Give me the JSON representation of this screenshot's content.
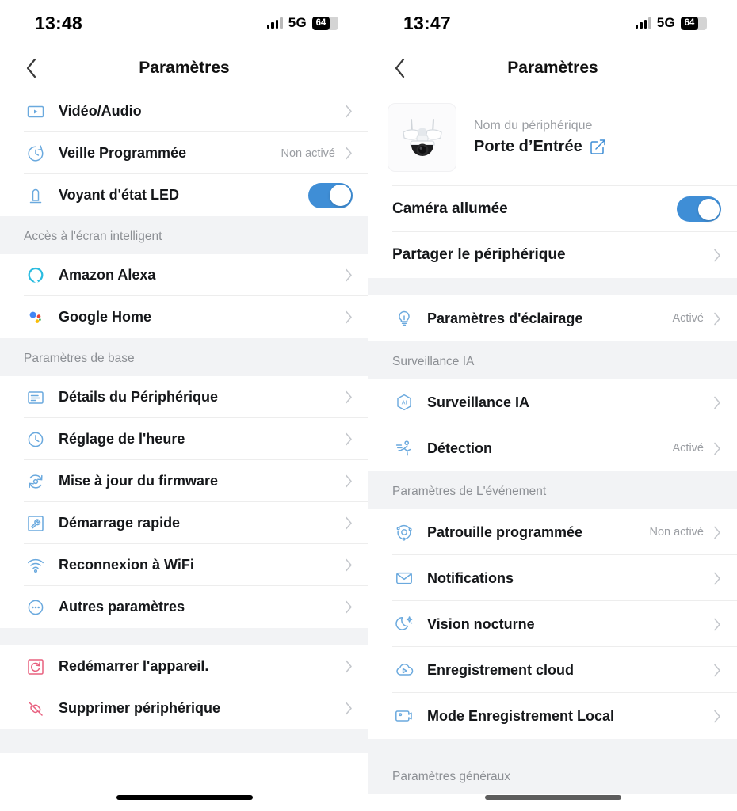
{
  "left": {
    "status": {
      "time": "13:48",
      "network": "5G",
      "battery": "64"
    },
    "nav": {
      "title": "Paramètres",
      "back": "back-chevron"
    },
    "sections": [
      {
        "header": null,
        "items": [
          {
            "icon": "video-audio-icon",
            "label": "Vidéo/Audio",
            "value": null,
            "control": "chevron"
          },
          {
            "icon": "scheduled-sleep-icon",
            "label": "Veille Programmée",
            "value": "Non activé",
            "control": "chevron"
          },
          {
            "icon": "led-indicator-icon",
            "label": "Voyant d'état LED",
            "value": null,
            "control": "toggle-on"
          }
        ]
      },
      {
        "header": "Accès à l'écran intelligent",
        "items": [
          {
            "icon": "amazon-alexa-icon",
            "label": "Amazon Alexa",
            "value": null,
            "control": "chevron"
          },
          {
            "icon": "google-home-icon",
            "label": "Google Home",
            "value": null,
            "control": "chevron"
          }
        ]
      },
      {
        "header": "Paramètres de base",
        "items": [
          {
            "icon": "device-details-icon",
            "label": "Détails du Périphérique",
            "value": null,
            "control": "chevron"
          },
          {
            "icon": "clock-icon",
            "label": "Réglage de l'heure",
            "value": null,
            "control": "chevron"
          },
          {
            "icon": "firmware-update-icon",
            "label": "Mise à jour du firmware",
            "value": null,
            "control": "chevron"
          },
          {
            "icon": "quick-start-icon",
            "label": "Démarrage rapide",
            "value": null,
            "control": "chevron"
          },
          {
            "icon": "wifi-icon",
            "label": "Reconnexion à WiFi",
            "value": null,
            "control": "chevron"
          },
          {
            "icon": "more-options-icon",
            "label": "Autres paramètres",
            "value": null,
            "control": "chevron"
          }
        ]
      },
      {
        "header": null,
        "items": [
          {
            "icon": "restart-device-icon",
            "label": "Redémarrer l'appareil.",
            "value": null,
            "control": "chevron"
          },
          {
            "icon": "unlink-device-icon",
            "label": "Supprimer périphérique",
            "value": null,
            "control": "chevron"
          }
        ]
      }
    ]
  },
  "right": {
    "status": {
      "time": "13:47",
      "network": "5G",
      "battery": "64"
    },
    "nav": {
      "title": "Paramètres",
      "back": "back-chevron"
    },
    "device": {
      "thumbnail": "floodlight-camera-thumbnail",
      "name_label": "Nom du périphérique",
      "name": "Porte d’Entrée",
      "edit_icon": "edit-pencil-icon"
    },
    "sections": [
      {
        "header": null,
        "items": [
          {
            "icon": null,
            "label": "Caméra allumée",
            "value": null,
            "control": "toggle-on"
          },
          {
            "icon": null,
            "label": "Partager le périphérique",
            "value": null,
            "control": "chevron"
          }
        ]
      },
      {
        "header": null,
        "items": [
          {
            "icon": "lighting-settings-icon",
            "label": "Paramètres d'éclairage",
            "value": "Activé",
            "control": "chevron"
          }
        ]
      },
      {
        "header": "Surveillance IA",
        "items": [
          {
            "icon": "ai-surveillance-icon",
            "label": "Surveillance IA",
            "value": null,
            "control": "chevron"
          },
          {
            "icon": "motion-detection-icon",
            "label": "Détection",
            "value": "Activé",
            "control": "chevron"
          }
        ]
      },
      {
        "header": "Paramètres de L'événement",
        "items": [
          {
            "icon": "scheduled-patrol-icon",
            "label": "Patrouille programmée",
            "value": "Non activé",
            "control": "chevron"
          },
          {
            "icon": "notifications-icon",
            "label": "Notifications",
            "value": null,
            "control": "chevron"
          },
          {
            "icon": "night-vision-icon",
            "label": "Vision nocturne",
            "value": null,
            "control": "chevron"
          },
          {
            "icon": "cloud-recording-icon",
            "label": "Enregistrement cloud",
            "value": null,
            "control": "chevron"
          },
          {
            "icon": "local-recording-icon",
            "label": "Mode Enregistrement Local",
            "value": null,
            "control": "chevron"
          }
        ]
      },
      {
        "header": "Paramètres généraux",
        "items": []
      }
    ]
  },
  "colors": {
    "accent_blue": "#3f8ed6",
    "icon_blue": "#6aa9de",
    "danger_red": "#e8607f",
    "group_bg": "#f2f3f5",
    "text": "#15171a",
    "muted": "#9b9ea3"
  }
}
